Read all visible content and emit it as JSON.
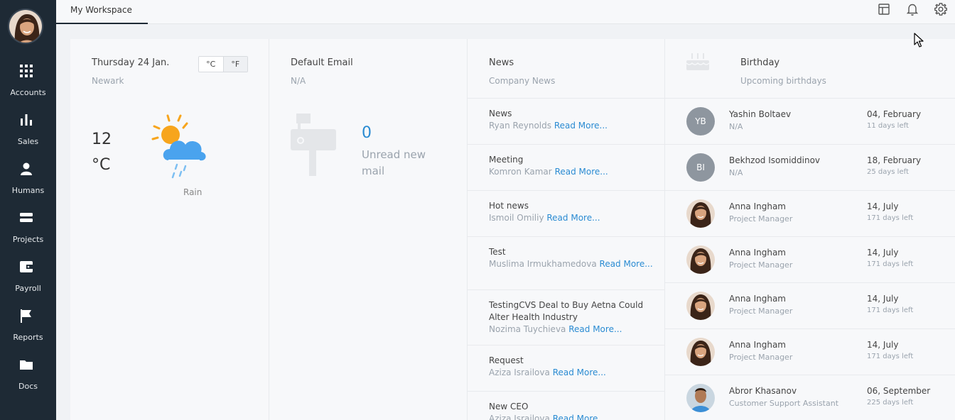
{
  "sidebar": {
    "items": [
      {
        "label": "Accounts",
        "icon": "grid-icon"
      },
      {
        "label": "Sales",
        "icon": "bar-chart-icon"
      },
      {
        "label": "Humans",
        "icon": "person-icon"
      },
      {
        "label": "Projects",
        "icon": "layers-icon"
      },
      {
        "label": "Payroll",
        "icon": "wallet-icon"
      },
      {
        "label": "Reports",
        "icon": "flag-icon"
      },
      {
        "label": "Docs",
        "icon": "folder-icon"
      }
    ]
  },
  "topbar": {
    "tab_label": "My Workspace",
    "icons": [
      "layout-icon",
      "bell-icon",
      "gear-icon"
    ]
  },
  "weather": {
    "date": "Thursday 24 Jan.",
    "city": "Newark",
    "unit_c": "°C",
    "unit_f": "°F",
    "temp_value": "12",
    "temp_unit": "°C",
    "condition": "Rain"
  },
  "email": {
    "title": "Default Email",
    "address": "N/A",
    "unread_count": "0",
    "unread_label": "Unread new mail"
  },
  "news": {
    "title": "News",
    "subtitle": "Company News",
    "read_more": "Read More...",
    "items": [
      {
        "title": "News",
        "author": "Ryan Reynolds"
      },
      {
        "title": "Meeting",
        "author": "Komron Kamar"
      },
      {
        "title": "Hot news",
        "author": "Ismoil Omiliy"
      },
      {
        "title": "Test",
        "author": "Muslima Irmukhamedova"
      },
      {
        "title": "TestingCVS Deal to Buy Aetna Could Alter Health Industry",
        "author": "Nozima Tuychieva"
      },
      {
        "title": "Request",
        "author": "Aziza Israilova"
      },
      {
        "title": "New CEO",
        "author": "Aziza Israilova"
      }
    ]
  },
  "birthday": {
    "title": "Birthday",
    "subtitle": "Upcoming birthdays",
    "people": [
      {
        "name": "Yashin Boltaev",
        "role": "N/A",
        "date": "04, February",
        "left": "11 days left",
        "initials": "YB"
      },
      {
        "name": "Bekhzod Isomiddinov",
        "role": "N/A",
        "date": "18, February",
        "left": "25 days left",
        "initials": "BI"
      },
      {
        "name": "Anna Ingham",
        "role": "Project Manager",
        "date": "14, July",
        "left": "171 days left",
        "initials": ""
      },
      {
        "name": "Anna Ingham",
        "role": "Project Manager",
        "date": "14, July",
        "left": "171 days left",
        "initials": ""
      },
      {
        "name": "Anna Ingham",
        "role": "Project Manager",
        "date": "14, July",
        "left": "171 days left",
        "initials": ""
      },
      {
        "name": "Anna Ingham",
        "role": "Project Manager",
        "date": "14, July",
        "left": "171 days left",
        "initials": ""
      },
      {
        "name": "Abror Khasanov",
        "role": "Customer Support Assistant",
        "date": "06, September",
        "left": "225 days left",
        "initials": ""
      }
    ]
  },
  "colors": {
    "sidebar_bg": "#1e2a35",
    "accent": "#2a8bd2",
    "muted": "#9aa3ad"
  }
}
